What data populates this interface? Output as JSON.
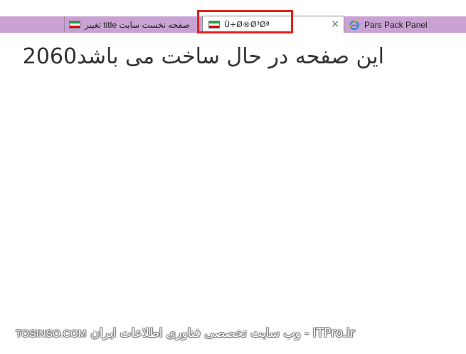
{
  "browser": {
    "tabs": [
      {
        "title": "تغییر title صفحه نخست سایت",
        "icon": "iran-flag-icon"
      },
      {
        "title": "Ù+Ø®Ø³Øª",
        "icon": "iran-flag-icon",
        "active": true,
        "close": "×"
      },
      {
        "title": "Pars Pack Panel",
        "icon": "internet-explorer-icon"
      }
    ],
    "highlight_color": "#e2231a",
    "tabstrip_color": "#c9a2d3"
  },
  "page": {
    "headline": "این صفحه در حال ساخت می باشد2060"
  },
  "watermark": {
    "brand": "TOSINSO.COM",
    "tagline": "ITPro.ir - وب سایت تخصصی فناوری اطلاعات ایران"
  }
}
